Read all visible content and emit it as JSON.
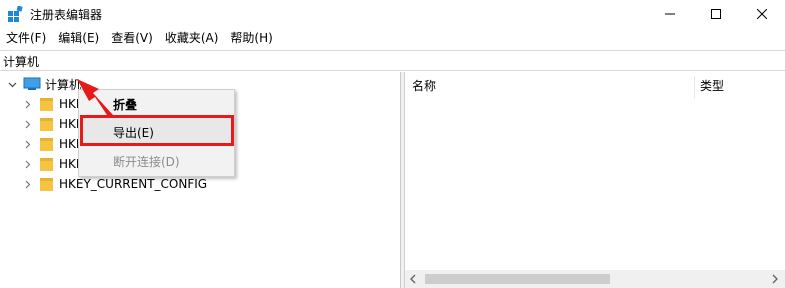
{
  "window": {
    "title": "注册表编辑器"
  },
  "menubar": {
    "items": [
      "文件(F)",
      "编辑(E)",
      "查看(V)",
      "收藏夹(A)",
      "帮助(H)"
    ]
  },
  "address": {
    "path": "计算机"
  },
  "tree": {
    "root_label": "计算机",
    "nodes": [
      "HKE",
      "HKE",
      "HKE",
      "HKE",
      "HKEY_CURRENT_CONFIG"
    ]
  },
  "list": {
    "columns": [
      "名称",
      "类型"
    ]
  },
  "context_menu": {
    "items": [
      "折叠",
      "导出(E)",
      "断开连接(D)"
    ]
  },
  "colors": {
    "highlight_border": "#e51b1b",
    "folder": "#f5c542"
  }
}
